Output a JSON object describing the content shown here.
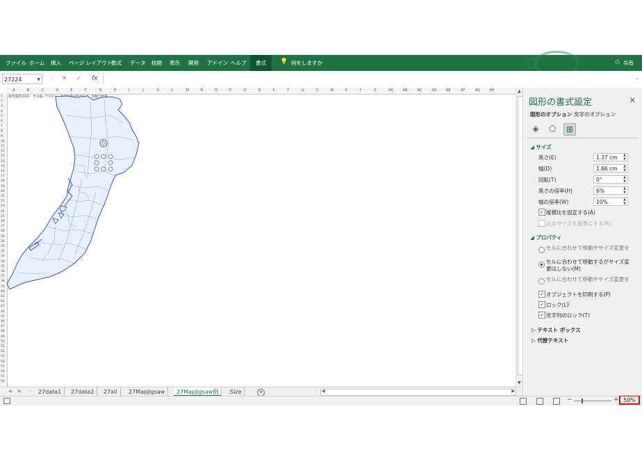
{
  "ribbon": {
    "tabs": [
      "ファイル",
      "ホーム",
      "挿入",
      "ページ レイアウト",
      "数式",
      "データ",
      "校閲",
      "表示",
      "開発",
      "アドイン",
      "ヘルプ"
    ],
    "active_tab": "書式",
    "tell_me": "何をしますか",
    "share": "共有"
  },
  "formula_bar": {
    "name_box": "27224",
    "fx": "fx"
  },
  "sheet": {
    "columns": [
      "A",
      "B",
      "C",
      "D",
      "E",
      "F",
      "G",
      "H",
      "I",
      "J",
      "K",
      "L",
      "M",
      "N",
      "O",
      "P",
      "Q",
      "R",
      "S",
      "T",
      "U",
      "V",
      "W",
      "X",
      "Y",
      "Z",
      "AA",
      "AB",
      "AC",
      "AD",
      "AE",
      "AF",
      "AG",
      "AH"
    ],
    "top_text": "表示倍率100%　セル幅=テキスト　元の位置は元のまま　参数で位置"
  },
  "sheet_tabs": [
    "27data1",
    "27data2",
    "27all",
    "27MapJigsaw",
    "27MapJigsaw例",
    "Size"
  ],
  "active_sheet": "27MapJigsaw例",
  "status": {
    "zoom": "50%"
  },
  "pane": {
    "title": "図形の書式設定",
    "tab_shape": "図形のオプション",
    "tab_text": "文字のオプション",
    "size_section": "サイズ",
    "fields": [
      {
        "label": "高さ(E)",
        "value": "1.37 cm"
      },
      {
        "label": "幅(D)",
        "value": "1.66 cm"
      },
      {
        "label": "回転(T)",
        "value": "0°"
      },
      {
        "label": "高さの倍率(H)",
        "value": "6%"
      },
      {
        "label": "幅の倍率(W)",
        "value": "10%"
      }
    ],
    "lock_aspect": "縦横比を固定する(A)",
    "relative_original": "元のサイズを基準にする(R)",
    "props_section": "プロパティ",
    "radio1": "セルに合わせて移動やサイズ変更をする(S)",
    "radio2": "セルに合わせて移動するがサイズ変更はしない(M)",
    "radio3": "セルに合わせて移動やサイズ変更をしない(D)",
    "print_object": "オブジェクトを印刷する(P)",
    "locked": "ロック(L)",
    "lock_text": "文字列のロック(T)",
    "textbox_section": "テキスト ボックス",
    "alt_text_section": "代替テキスト"
  }
}
